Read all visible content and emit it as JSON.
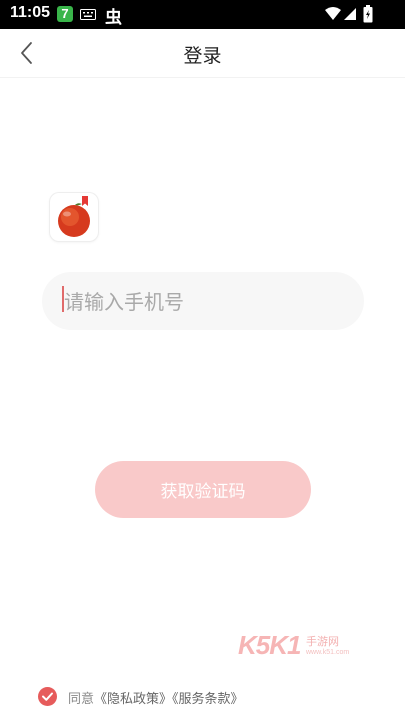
{
  "status_bar": {
    "time": "11:05",
    "app_badge": "7",
    "icons": [
      "app-7-icon",
      "keyboard-icon",
      "bug-icon",
      "wifi-icon",
      "cell-signal-icon",
      "battery-icon"
    ]
  },
  "header": {
    "title": "登录",
    "back_icon": "chevron-left-icon"
  },
  "logo": {
    "icon": "tomato-app-logo"
  },
  "phone_input": {
    "value": "",
    "placeholder": "请输入手机号"
  },
  "get_code_button": {
    "label": "获取验证码",
    "enabled": false
  },
  "agreement": {
    "checked": true,
    "prefix": "同意",
    "privacy_policy": "《隐私政策》",
    "terms_of_service": "《服务条款》"
  },
  "watermark": {
    "logo_text": "K5K1",
    "sub_text": "手游网",
    "url": "www.k51.com"
  },
  "colors": {
    "accent": "#e65b5b",
    "button_disabled": "#f9c9c9",
    "input_background": "#f7f7f7",
    "status_bar": "#000000"
  }
}
